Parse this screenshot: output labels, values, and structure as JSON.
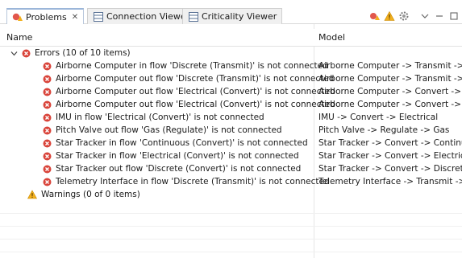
{
  "tabs": [
    {
      "label": "Problems",
      "close": "✕",
      "icon": "problems-icon",
      "active": true
    },
    {
      "label": "Connection Viewer",
      "icon": "table-icon",
      "active": false
    },
    {
      "label": "Criticality Viewer",
      "icon": "table-icon",
      "active": false
    }
  ],
  "toolbar": {
    "icons": [
      "alert-icon",
      "warning-icon",
      "gear-icon",
      "view-menu-icon",
      "minimize-icon",
      "maximize-icon"
    ]
  },
  "columns": {
    "name": "Name",
    "model": "Model"
  },
  "errors_group": {
    "label": "Errors (10 of 10 items)",
    "expanded": true
  },
  "errors": [
    {
      "desc": "Airborne Computer in flow 'Discrete (Transmit)' is not connected",
      "model": "Airborne Computer -> Transmit -> ..."
    },
    {
      "desc": "Airborne Computer out flow 'Discrete (Transmit)' is not connected",
      "model": "Airborne Computer -> Transmit -> ..."
    },
    {
      "desc": "Airborne Computer out flow 'Electrical (Convert)' is not connected",
      "model": "Airborne Computer -> Convert -> El..."
    },
    {
      "desc": "Airborne Computer out flow 'Electrical (Convert)' is not connected",
      "model": "Airborne Computer -> Convert -> El..."
    },
    {
      "desc": "IMU  in flow 'Electrical (Convert)' is not connected",
      "model": "IMU  -> Convert -> Electrical"
    },
    {
      "desc": "Pitch Valve out flow 'Gas (Regulate)' is not connected",
      "model": "Pitch Valve -> Regulate -> Gas"
    },
    {
      "desc": "Star Tracker in flow 'Continuous (Convert)' is not connected",
      "model": "Star Tracker -> Convert -> Continuous"
    },
    {
      "desc": "Star Tracker in flow 'Electrical (Convert)' is not connected",
      "model": "Star Tracker -> Convert -> Electrical"
    },
    {
      "desc": "Star Tracker out flow 'Discrete (Convert)' is not connected",
      "model": "Star Tracker -> Convert -> Discrete"
    },
    {
      "desc": "Telemetry Interface in flow 'Discrete (Transmit)' is not connected",
      "model": "Telemetry Interface -> Transmit -> D..."
    }
  ],
  "warnings_group": {
    "label": "Warnings (0 of 0 items)"
  },
  "colors": {
    "error": "#d9443a",
    "warning": "#e8a317",
    "tab_border": "#9bb6d9"
  }
}
